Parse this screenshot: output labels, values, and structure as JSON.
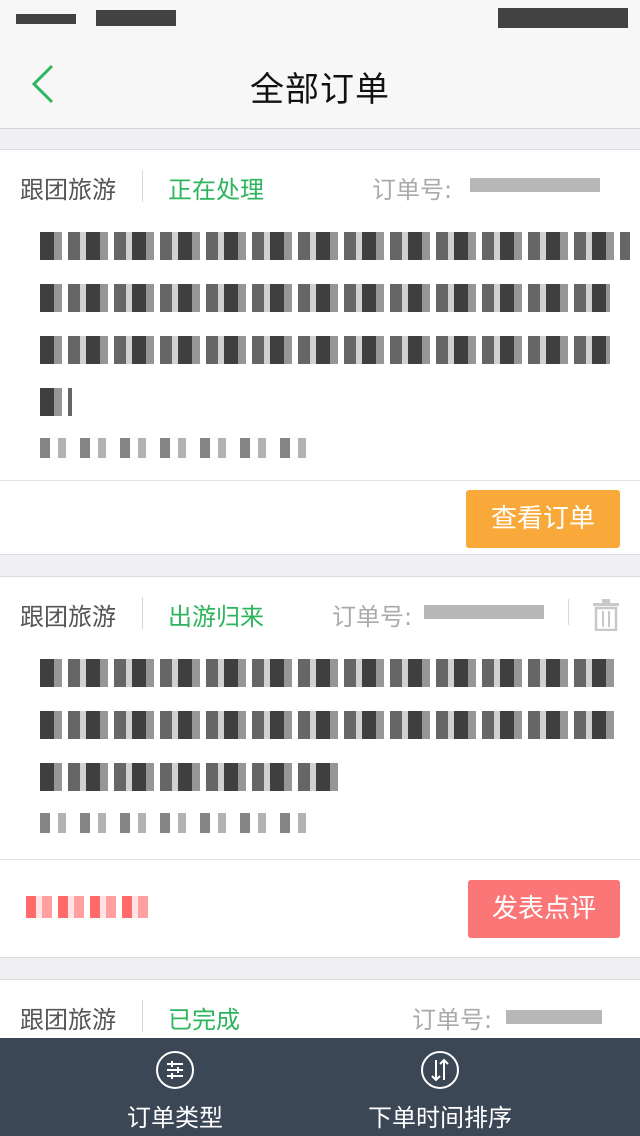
{
  "nav": {
    "title": "全部订单"
  },
  "orders": [
    {
      "type": "跟团旅游",
      "status": "正在处理",
      "order_label": "订单号:",
      "action": "查看订单"
    },
    {
      "type": "跟团旅游",
      "status": "出游归来",
      "order_label": "订单号:",
      "action": "发表点评"
    },
    {
      "type": "跟团旅游",
      "status": "已完成",
      "order_label": "订单号:"
    }
  ],
  "tabbar": {
    "type_label": "订单类型",
    "sort_label": "下单时间排序"
  },
  "colors": {
    "accent_green": "#2db55d",
    "btn_orange": "#f8a93a",
    "btn_red": "#fb7676",
    "tabbar": "#3c4756"
  },
  "icons": {
    "back": "chevron-left-icon",
    "trash": "trash-icon",
    "filter": "sliders-icon",
    "sort": "sort-arrows-icon"
  }
}
